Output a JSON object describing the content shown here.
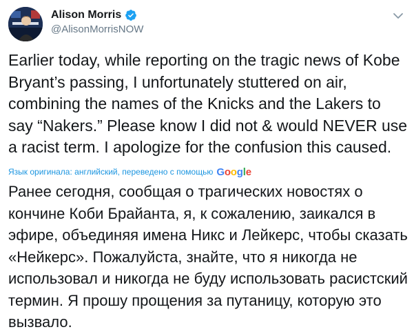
{
  "author": {
    "display_name": "Alison Morris",
    "handle": "@AlisonMorrisNOW",
    "verified_icon": "verified-badge-icon",
    "avatar_icon": "profile-avatar"
  },
  "menu_icon": "chevron-down-icon",
  "tweet": {
    "text": "Earlier today, while reporting on the tragic news of Kobe Bryant’s passing, I unfortunately stuttered on air, combining the names of the Knicks and the Lakers to say “Nakers.” Please know I did not & would NEVER use a racist term. I apologize for the confusion this caused."
  },
  "translation": {
    "meta_label": "Язык оригинала: английский, переведено с помощью",
    "provider": {
      "letters": [
        "G",
        "o",
        "o",
        "g",
        "l",
        "e"
      ]
    },
    "text": "Ранее сегодня, сообщая о трагических новостях о кончине Коби Брайанта, я, к сожалению, заикался в эфире, объединяя имена Никс и Лейкерс, чтобы сказать «Нейкерс». Пожалуйста, знайте, что я никогда не использовал и никогда не буду использовать расистский термин. Я прошу прощения за путаницу, которую это вызвало."
  },
  "colors": {
    "text": "#14171a",
    "secondary": "#657786",
    "accent": "#1da1f2",
    "link": "#1b95e0"
  }
}
